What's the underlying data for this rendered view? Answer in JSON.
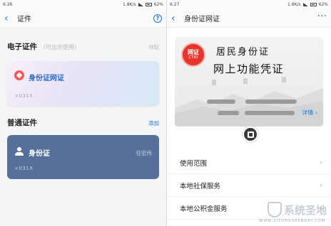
{
  "left": {
    "status": {
      "time": "6:26",
      "speed": "1.8K/s",
      "battery": "62%"
    },
    "nav": {
      "title": "证件",
      "back": "‹",
      "help": "?"
    },
    "electronic": {
      "heading": "电子证件",
      "hint": "（可出示使用）",
      "action": "领取"
    },
    "e_card": {
      "name": "身份证网证",
      "number": "×031X"
    },
    "normal": {
      "heading": "普通证件",
      "action": "添加"
    },
    "n_card": {
      "name": "身份证",
      "number": "×031X",
      "owner": "任宏伟"
    }
  },
  "right": {
    "status": {
      "time": "6:27",
      "speed": "1.8K/s",
      "battery": "62%"
    },
    "nav": {
      "title": "身份证网证",
      "back": "‹",
      "more": "···"
    },
    "card": {
      "seal_line1": "网证",
      "seal_line2": "CTID",
      "title1": "居民身份证",
      "title2": "网上功能凭证",
      "detail": "详情 ›"
    },
    "menu": [
      {
        "label": "使用范围"
      },
      {
        "label": "本地社保服务"
      },
      {
        "label": "本地公积金服务"
      }
    ],
    "watermark": {
      "text": "系统圣地",
      "sub": "WWW.XITONGSHENGDI.COM"
    }
  },
  "colors": {
    "accent": "#1677d8",
    "seal": "#e5352c",
    "normal_card": "#56709a"
  }
}
